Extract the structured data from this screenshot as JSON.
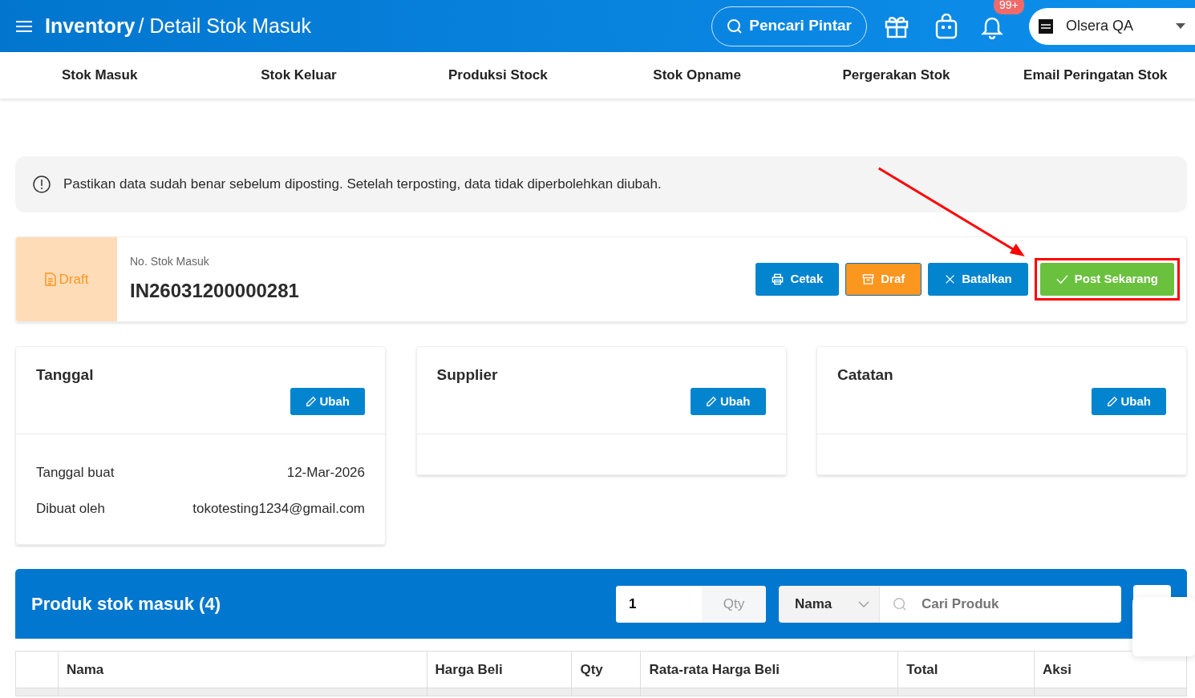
{
  "header": {
    "breadcrumb": [
      "Inventory",
      "/ Detail Stok Masuk"
    ],
    "search_button": "Pencari Pintar",
    "notification_badge": "99+",
    "store": "Olsera QA"
  },
  "tabs": [
    "Stok Masuk",
    "Stok Keluar",
    "Produksi Stock",
    "Stok Opname",
    "Pergerakan Stok",
    "Email Peringatan Stok"
  ],
  "alert": "Pastikan data sudah benar sebelum diposting. Setelah terposting, data tidak diperbolehkan diubah.",
  "document": {
    "status": {
      "label": "Draft",
      "kind": "draft"
    },
    "number_label": "No. Stok Masuk",
    "number": "IN26031200000281",
    "actions": [
      {
        "label": "Cetak",
        "kind": "print",
        "highlighted": false
      },
      {
        "label": "Draf",
        "kind": "draft",
        "highlighted": false
      },
      {
        "label": "Batalkan",
        "kind": "cancel",
        "highlighted": false
      },
      {
        "label": "Post Sekarang",
        "kind": "post",
        "highlighted": true
      }
    ]
  },
  "info_cards": [
    {
      "title": "Tanggal",
      "button": "Ubah",
      "rows": [
        {
          "label": "Tanggal buat",
          "value": "12-Mar-2026"
        },
        {
          "label": "Dibuat oleh",
          "value": "tokotesting1234@gmail.com"
        }
      ]
    },
    {
      "title": "Supplier",
      "button": "Ubah"
    },
    {
      "title": "Catatan",
      "button": "Ubah"
    }
  ],
  "products": {
    "title": "Produk stok masuk (4)",
    "qty_value": "1",
    "qty_addon": "Qty",
    "search_by": "Nama",
    "search_placeholder": "Cari Produk",
    "columns": [
      "",
      "Nama",
      "Harga Beli",
      "Qty",
      "Rata-rata Harga Beli",
      "Total",
      "Aksi"
    ]
  }
}
